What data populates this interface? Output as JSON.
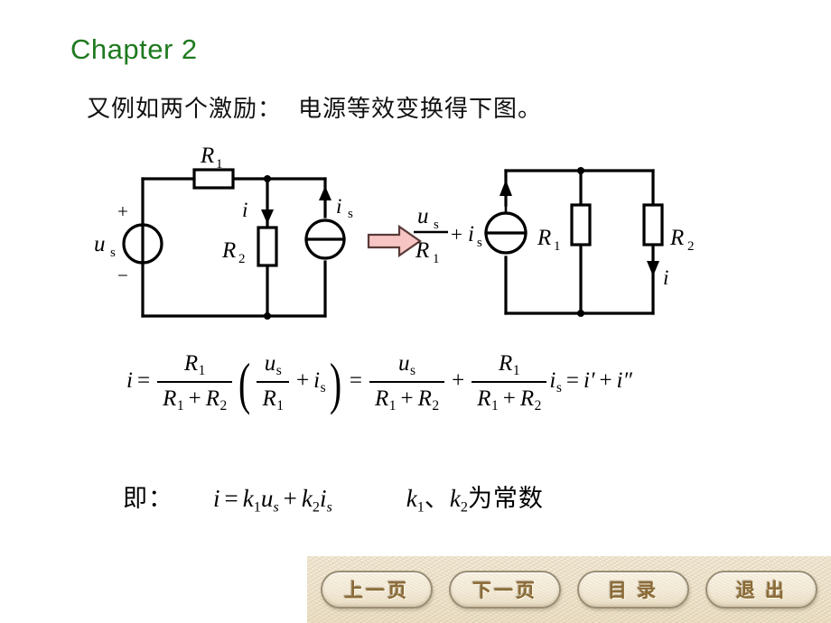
{
  "slide": {
    "title": "Chapter 2",
    "title_color": "#1f7a1f",
    "background": "#ffffff"
  },
  "intro": {
    "part1": "又例如两个激励：",
    "part2": "电源等效变换得下图。"
  },
  "left_circuit": {
    "name": "original-two-source-circuit",
    "labels": {
      "voltage_source": "u",
      "voltage_source_sub": "s",
      "plus_sign": "+",
      "minus_sign": "−",
      "resistor1": "R",
      "resistor1_sub": "1",
      "resistor2": "R",
      "resistor2_sub": "2",
      "branch_current": "i",
      "current_source": "i",
      "current_source_sub": "s"
    }
  },
  "transform_arrow": {
    "name": "equivalence-arrow",
    "fill": "#f7c6c4",
    "stroke": "#5a3a38"
  },
  "right_circuit": {
    "name": "equivalent-current-source-circuit",
    "source_expression": {
      "numerator": "u",
      "numerator_sub": "s",
      "denominator": "R",
      "denominator_sub": "1",
      "operator": "+",
      "addend": "i",
      "addend_sub": "s"
    },
    "labels": {
      "resistor1": "R",
      "resistor1_sub": "1",
      "resistor2": "R",
      "resistor2_sub": "2",
      "branch_current": "i"
    }
  },
  "main_equation": {
    "i": "i",
    "eq1": "=",
    "f1_num": "R",
    "f1_num_sub": "1",
    "f1_den_a": "R",
    "f1_den_a_sub": "1",
    "f1_den_op": "+",
    "f1_den_b": "R",
    "f1_den_b_sub": "2",
    "lparen": "(",
    "f2_num": "u",
    "f2_num_sub": "s",
    "f2_den": "R",
    "f2_den_sub": "1",
    "inner_op": "+",
    "inner_i": "i",
    "inner_i_sub": "s",
    "rparen": ")",
    "eq2": "=",
    "f3_num": "u",
    "f3_num_sub": "s",
    "f3_den_a": "R",
    "f3_den_a_sub": "1",
    "f3_den_op": "+",
    "f3_den_b": "R",
    "f3_den_b_sub": "2",
    "op_plus": "+",
    "f4_num": "R",
    "f4_num_sub": "1",
    "f4_den_a": "R",
    "f4_den_a_sub": "1",
    "f4_den_op": "+",
    "f4_den_b": "R",
    "f4_den_b_sub": "2",
    "trail_i": "i",
    "trail_i_sub": "s",
    "eq3": "=",
    "i_prime": "i′",
    "plus_last": "+",
    "i_dprime": "i″"
  },
  "final_line": {
    "prefix": "即：",
    "i": "i",
    "equals": "=",
    "k1": "k",
    "k1_sub": "1",
    "u": "u",
    "u_sub": "s",
    "plus": "+",
    "k2": "k",
    "k2_sub": "2",
    "i2": "i",
    "i2_sub": "s",
    "note_k1": "k",
    "note_k1_sub": "1",
    "note_sep": "、",
    "note_k2": "k",
    "note_k2_sub": "2",
    "note_text": "为常数"
  },
  "navbar": {
    "buttons": [
      {
        "id": "prev-page",
        "label": "上一页"
      },
      {
        "id": "next-page",
        "label": "下一页"
      },
      {
        "id": "contents",
        "label": "目  录"
      },
      {
        "id": "exit",
        "label": "退  出"
      }
    ]
  }
}
